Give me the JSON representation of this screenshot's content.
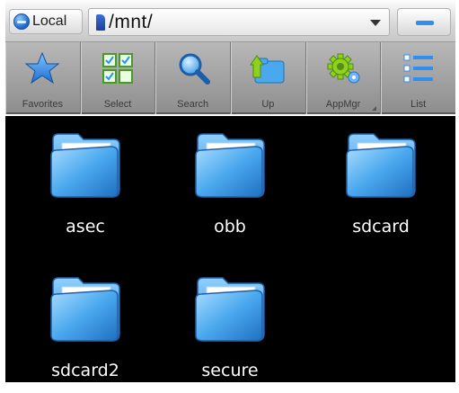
{
  "location_button": {
    "label": "Local",
    "icon": "globe-icon"
  },
  "path_bar": {
    "path": "/mnt/",
    "icon": "sdcard-icon"
  },
  "minus_button": {
    "icon": "minus-icon"
  },
  "toolbar": {
    "items": [
      {
        "label": "Favorites",
        "icon": "star-icon"
      },
      {
        "label": "Select",
        "icon": "select-grid-icon"
      },
      {
        "label": "Search",
        "icon": "search-icon"
      },
      {
        "label": "Up",
        "icon": "folder-up-icon"
      },
      {
        "label": "AppMgr",
        "icon": "gear-icon"
      },
      {
        "label": "List",
        "icon": "list-view-icon"
      }
    ]
  },
  "files": [
    {
      "name": "asec",
      "type": "folder"
    },
    {
      "name": "obb",
      "type": "folder"
    },
    {
      "name": "sdcard",
      "type": "folder"
    },
    {
      "name": "sdcard2",
      "type": "folder"
    },
    {
      "name": "secure",
      "type": "folder"
    }
  ],
  "colors": {
    "accent": "#2f8ff0",
    "folder": "#4aa8ee",
    "background": "#000000"
  }
}
